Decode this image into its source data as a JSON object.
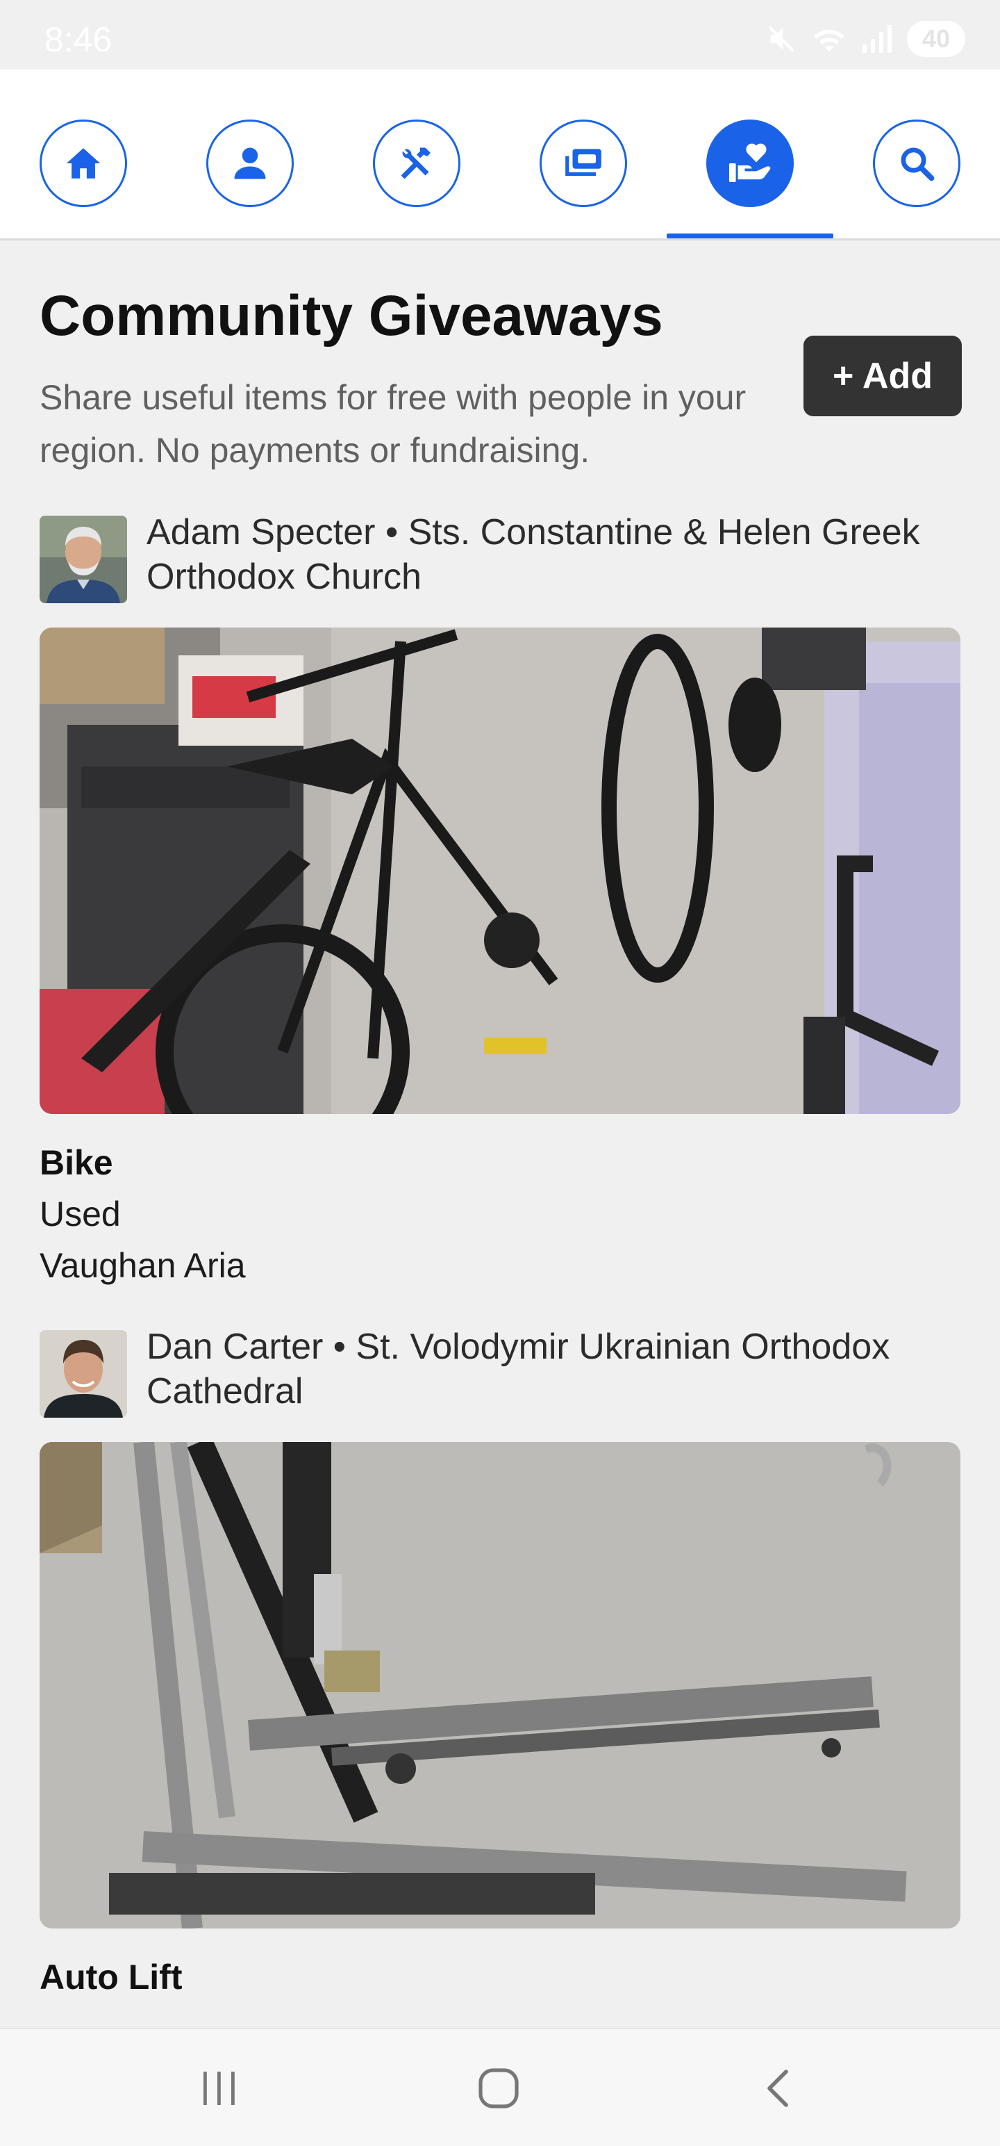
{
  "status_bar": {
    "time": "8:46",
    "battery": "40",
    "icons": [
      "mute-icon",
      "wifi-icon",
      "signal-icon",
      "battery-icon"
    ]
  },
  "nav": {
    "accent_color": "#1a63e8",
    "active_tab": "giveaways",
    "tabs": [
      {
        "id": "home",
        "icon": "home-icon"
      },
      {
        "id": "profile",
        "icon": "person-icon"
      },
      {
        "id": "tools",
        "icon": "tools-icon"
      },
      {
        "id": "money",
        "icon": "money-icon"
      },
      {
        "id": "giveaways",
        "icon": "hand-heart-icon"
      },
      {
        "id": "search",
        "icon": "search-icon"
      }
    ]
  },
  "header": {
    "title": "Community Giveaways",
    "subtitle": "Share useful items for free with people in your region. No payments or fundraising.",
    "add_label": "+ Add"
  },
  "posts": [
    {
      "poster": "Adam Specter • Sts. Constantine & Helen Greek Orthodox Church",
      "item": "Bike",
      "condition": "Used",
      "location": "Vaughan Aria"
    },
    {
      "poster": "Dan Carter • St. Volodymir Ukrainian Orthodox Cathedral",
      "item": "Auto Lift"
    }
  ],
  "system_nav": [
    "recent-apps-icon",
    "home-circle-icon",
    "back-icon"
  ]
}
